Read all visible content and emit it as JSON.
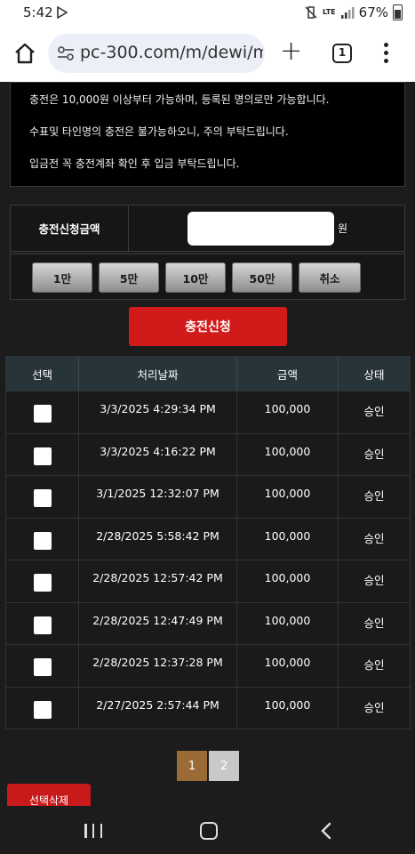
{
  "status_bar": {
    "time": "5:42",
    "network": "LTE",
    "battery": "67%"
  },
  "browser": {
    "url": "pc-300.com/m/dewi/m",
    "tab_count": "1"
  },
  "notice": {
    "lines": [
      "충전은 10,000원 이상부터 가능하며, 등록된 명의로만 가능합니다.",
      "수표및 타인명의 충전은 불가능하오니, 주의 부탁드립니다.",
      "입금전 꼭 충전계좌 확인 후 입금 부탁드립니다."
    ]
  },
  "form": {
    "amount_label": "충전신청금액",
    "amount_value": "",
    "unit": "원",
    "quick_buttons": [
      "1만",
      "5만",
      "10만",
      "50만",
      "취소"
    ],
    "submit_label": "충전신청"
  },
  "table": {
    "headers": [
      "선택",
      "처리날짜",
      "금액",
      "상태"
    ],
    "rows": [
      {
        "date": "3/3/2025 4:29:34 PM",
        "amount": "100,000",
        "status": "승인"
      },
      {
        "date": "3/3/2025 4:16:22 PM",
        "amount": "100,000",
        "status": "승인"
      },
      {
        "date": "3/1/2025 12:32:07 PM",
        "amount": "100,000",
        "status": "승인"
      },
      {
        "date": "2/28/2025 5:58:42 PM",
        "amount": "100,000",
        "status": "승인"
      },
      {
        "date": "2/28/2025 12:57:42 PM",
        "amount": "100,000",
        "status": "승인"
      },
      {
        "date": "2/28/2025 12:47:49 PM",
        "amount": "100,000",
        "status": "승인"
      },
      {
        "date": "2/28/2025 12:37:28 PM",
        "amount": "100,000",
        "status": "승인"
      },
      {
        "date": "2/27/2025 2:57:44 PM",
        "amount": "100,000",
        "status": "승인"
      }
    ]
  },
  "pagination": {
    "pages": [
      "1",
      "2"
    ],
    "current": "1"
  },
  "delete_label": "선택삭제",
  "colors": {
    "accent_red": "#d21a1a",
    "page_active": "#9a6b35",
    "page_inactive": "#c8c8c8",
    "header_bg": "#27343a"
  }
}
